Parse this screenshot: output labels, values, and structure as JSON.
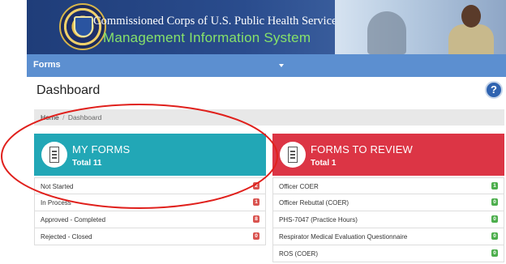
{
  "header": {
    "title": "Commissioned Corps of U.S. Public Health Service",
    "subtitle": "Management Information System",
    "seal": "phs-seal-logo"
  },
  "navbar": {
    "menu_label": "Forms"
  },
  "page": {
    "title": "Dashboard",
    "help_label": "?"
  },
  "breadcrumb": {
    "home": "Home",
    "separator": "/",
    "current": "Dashboard"
  },
  "my_forms": {
    "title": "MY FORMS",
    "total": "Total 11",
    "color": "#22a7b6",
    "items": [
      {
        "label": "Not Started",
        "count": "2",
        "badge": "red"
      },
      {
        "label": "In Process",
        "count": "1",
        "badge": "red"
      },
      {
        "label": "Approved - Completed",
        "count": "8",
        "badge": "red"
      },
      {
        "label": "Rejected - Closed",
        "count": "0",
        "badge": "red"
      }
    ]
  },
  "forms_to_review": {
    "title": "FORMS TO REVIEW",
    "total": "Total 1",
    "color": "#dc3545",
    "items": [
      {
        "label": "Officer COER",
        "count": "1",
        "badge": "green"
      },
      {
        "label": "Officer Rebuttal (COER)",
        "count": "0",
        "badge": "green"
      },
      {
        "label": "PHS-7047 (Practice Hours)",
        "count": "0",
        "badge": "green"
      },
      {
        "label": "Respirator Medical Evaluation Questionnaire",
        "count": "0",
        "badge": "green"
      },
      {
        "label": "ROS (COER)",
        "count": "0",
        "badge": "green"
      }
    ]
  },
  "annotation": {
    "color": "#e0201c"
  }
}
